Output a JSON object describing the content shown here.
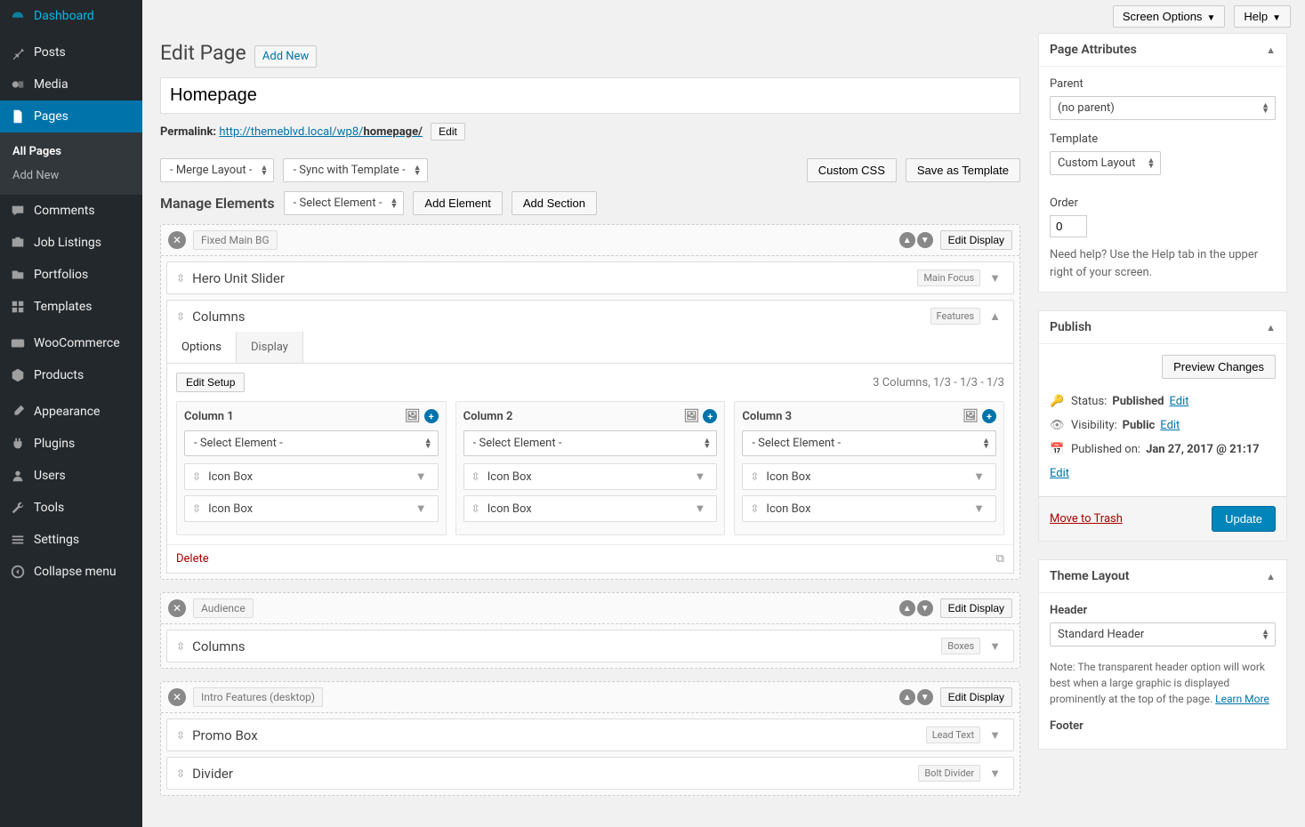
{
  "topbar": {
    "screen_options": "Screen Options",
    "help": "Help"
  },
  "sidebar": {
    "items": [
      {
        "label": "Dashboard",
        "icon": "dashboard"
      },
      {
        "label": "Posts",
        "icon": "pin"
      },
      {
        "label": "Media",
        "icon": "media"
      },
      {
        "label": "Pages",
        "icon": "page"
      },
      {
        "label": "Comments",
        "icon": "comment"
      },
      {
        "label": "Job Listings",
        "icon": "briefcase"
      },
      {
        "label": "Portfolios",
        "icon": "portfolio"
      },
      {
        "label": "Templates",
        "icon": "templates"
      },
      {
        "label": "WooCommerce",
        "icon": "woo"
      },
      {
        "label": "Products",
        "icon": "box"
      },
      {
        "label": "Appearance",
        "icon": "brush"
      },
      {
        "label": "Plugins",
        "icon": "plug"
      },
      {
        "label": "Users",
        "icon": "user"
      },
      {
        "label": "Tools",
        "icon": "wrench"
      },
      {
        "label": "Settings",
        "icon": "sliders"
      },
      {
        "label": "Collapse menu",
        "icon": "collapse"
      }
    ],
    "submenu": {
      "all_pages": "All Pages",
      "add_new": "Add New"
    }
  },
  "editor": {
    "title": "Edit Page",
    "add_new": "Add New",
    "post_title": "Homepage",
    "permalink_label": "Permalink:",
    "permalink_base": "http://themeblvd.local/wp8/",
    "permalink_slug": "homepage/",
    "edit_btn": "Edit",
    "merge_layout": "- Merge Layout -",
    "sync_template": "- Sync with Template -",
    "custom_css": "Custom CSS",
    "save_template": "Save as Template",
    "manage_elements": "Manage Elements",
    "select_element": "- Select Element -",
    "add_element": "Add Element",
    "add_section": "Add Section"
  },
  "sections": [
    {
      "name": "Fixed Main BG",
      "edit_display": "Edit Display",
      "elements": [
        {
          "title": "Hero Unit Slider",
          "badge": "Main Focus"
        },
        {
          "title": "Columns",
          "badge": "Features",
          "expanded": true
        }
      ],
      "columns_panel": {
        "tabs": {
          "options": "Options",
          "display": "Display"
        },
        "edit_setup": "Edit Setup",
        "summary": "3 Columns, 1/3 - 1/3 - 1/3",
        "cols": [
          {
            "title": "Column 1",
            "select": "- Select Element -",
            "rows": [
              "Icon Box",
              "Icon Box"
            ]
          },
          {
            "title": "Column 2",
            "select": "- Select Element -",
            "rows": [
              "Icon Box",
              "Icon Box"
            ]
          },
          {
            "title": "Column 3",
            "select": "- Select Element -",
            "rows": [
              "Icon Box",
              "Icon Box"
            ]
          }
        ],
        "delete": "Delete"
      }
    },
    {
      "name": "Audience",
      "edit_display": "Edit Display",
      "elements": [
        {
          "title": "Columns",
          "badge": "Boxes"
        }
      ]
    },
    {
      "name": "Intro Features (desktop)",
      "edit_display": "Edit Display",
      "elements": [
        {
          "title": "Promo Box",
          "badge": "Lead Text"
        },
        {
          "title": "Divider",
          "badge": "Bolt Divider"
        }
      ]
    }
  ],
  "page_attributes": {
    "title": "Page Attributes",
    "parent_label": "Parent",
    "parent_value": "(no parent)",
    "template_label": "Template",
    "template_value": "Custom Layout",
    "order_label": "Order",
    "order_value": "0",
    "help": "Need help? Use the Help tab in the upper right of your screen."
  },
  "publish": {
    "title": "Publish",
    "preview": "Preview Changes",
    "status_label": "Status:",
    "status_value": "Published",
    "visibility_label": "Visibility:",
    "visibility_value": "Public",
    "published_label": "Published on:",
    "published_value": "Jan 27, 2017 @ 21:17",
    "edit": "Edit",
    "trash": "Move to Trash",
    "update": "Update"
  },
  "theme_layout": {
    "title": "Theme Layout",
    "header_label": "Header",
    "header_value": "Standard Header",
    "note": "Note: The transparent header option will work best when a large graphic is displayed prominently at the top of the page.",
    "learn_more": "Learn More",
    "footer_label": "Footer"
  }
}
